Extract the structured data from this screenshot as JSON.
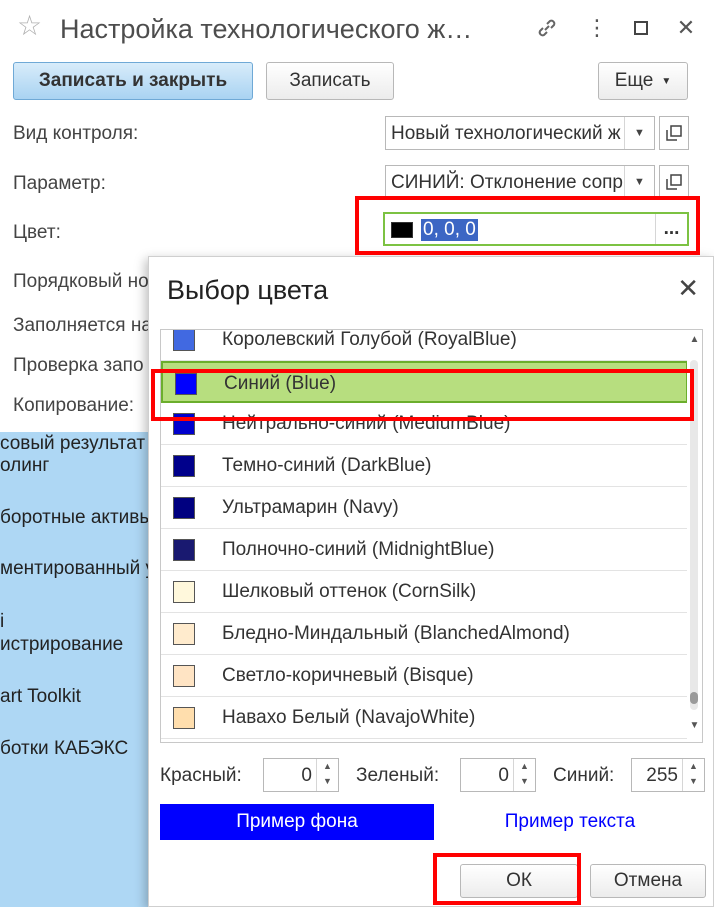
{
  "window": {
    "title": "Настройка технологического ж…"
  },
  "toolbar": {
    "save_close_label": "Записать и закрыть",
    "save_label": "Записать",
    "more_label": "Еще"
  },
  "form": {
    "control_type_label": "Вид контроля:",
    "control_type_value": "Новый технологический ж",
    "parameter_label": "Параметр:",
    "parameter_value": "СИНИЙ: Отклонение сопр",
    "color_label": "Цвет:",
    "color_value": "0, 0, 0",
    "color_swatch": "#000000",
    "order_label": "Порядковый но",
    "filled_label": "Заполняется на",
    "check_label": "Проверка запо",
    "copy_label": "Копирование:"
  },
  "sidebar": {
    "items": [
      "совый результат",
      "олинг",
      "боротные активы",
      "ментированный у",
      "і",
      "истрирование",
      "art Toolkit",
      "ботки КАБЭКС"
    ]
  },
  "dialog": {
    "title": "Выбор цвета",
    "colors": [
      {
        "label": "Королевский Голубой (RoyalBlue)",
        "hex": "#4169e1"
      },
      {
        "label": "Синий (Blue)",
        "hex": "#0000ff"
      },
      {
        "label": "Нейтрально-синий (MediumBlue)",
        "hex": "#0000cd"
      },
      {
        "label": "Темно-синий (DarkBlue)",
        "hex": "#00008b"
      },
      {
        "label": "Ультрамарин (Navy)",
        "hex": "#000080"
      },
      {
        "label": "Полночно-синий (MidnightBlue)",
        "hex": "#191970"
      },
      {
        "label": "Шелковый оттенок (CornSilk)",
        "hex": "#fff8dc"
      },
      {
        "label": "Бледно-Миндальный (BlanchedAlmond)",
        "hex": "#ffebcd"
      },
      {
        "label": "Светло-коричневый (Bisque)",
        "hex": "#ffe4c4"
      },
      {
        "label": "Навахо Белый (NavajoWhite)",
        "hex": "#ffdead"
      }
    ],
    "selected_index": 1,
    "red_label": "Красный:",
    "red_value": "0",
    "green_label": "Зеленый:",
    "green_value": "0",
    "blue_label": "Синий:",
    "blue_value": "255",
    "sample_bg_label": "Пример фона",
    "sample_text_label": "Пример текста",
    "ok_label": "ОК",
    "cancel_label": "Отмена"
  },
  "colors": {
    "highlight_red": "#ff0000",
    "selected_row": "#b7de7f",
    "sidebar_bg": "#aed7f4",
    "primary_button": "#a9d3f2"
  }
}
